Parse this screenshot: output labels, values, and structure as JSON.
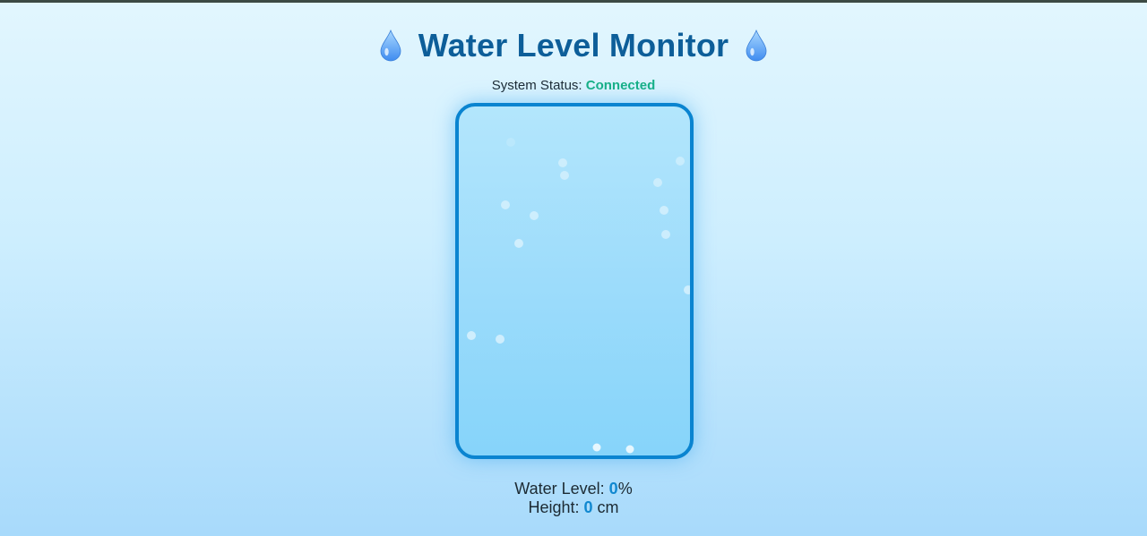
{
  "header": {
    "title": "Water Level Monitor",
    "left_icon": "water-drop-icon",
    "right_icon": "water-drop-icon"
  },
  "status": {
    "label": "System Status:",
    "value": "Connected",
    "value_color": "#17b087"
  },
  "tank": {
    "level_percent": 0,
    "border_color": "#0a84d0"
  },
  "readout": {
    "level_label": "Water Level:",
    "level_value": "0",
    "level_unit": "%",
    "height_label": "Height:",
    "height_value": "0",
    "height_unit": "cm"
  },
  "colors": {
    "title": "#0d5e99",
    "accent": "#1188d0"
  }
}
